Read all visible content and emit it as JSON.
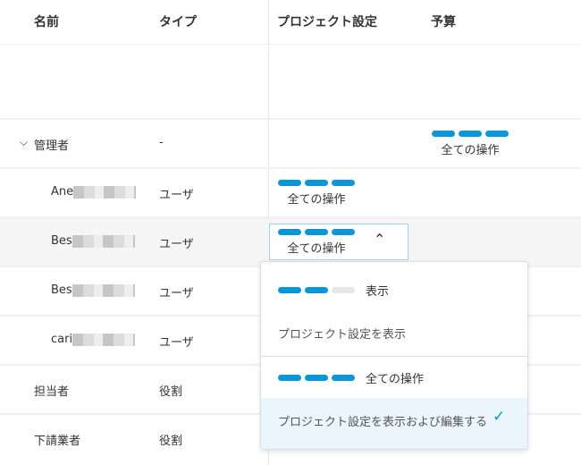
{
  "header": {
    "name": "名前",
    "type": "タイプ",
    "project_settings": "プロジェクト設定",
    "budget": "予算"
  },
  "rows": [
    {
      "name": "管理者",
      "type": "-",
      "budget_perm": "全ての操作"
    },
    {
      "name": "Ane",
      "type": "ユーザ",
      "project_perm": "全ての操作"
    },
    {
      "name": "Bes",
      "type": "ユーザ",
      "project_perm": "全ての操作"
    },
    {
      "name": "Bes",
      "type": "ユーザ"
    },
    {
      "name": "cari",
      "type": "ユーザ"
    },
    {
      "name": "担当者",
      "type": "役割"
    },
    {
      "name": "下請業者",
      "type": "役割"
    }
  ],
  "dropdown": {
    "options": [
      {
        "level": "表示",
        "description": "プロジェクト設定を表示",
        "filled": 2
      },
      {
        "level": "全ての操作",
        "description": "プロジェクト設定を表示および編集する",
        "filled": 3,
        "selected": true
      }
    ]
  },
  "colors": {
    "accent": "#0a96d8",
    "selected_bg": "#ebf6fc"
  }
}
